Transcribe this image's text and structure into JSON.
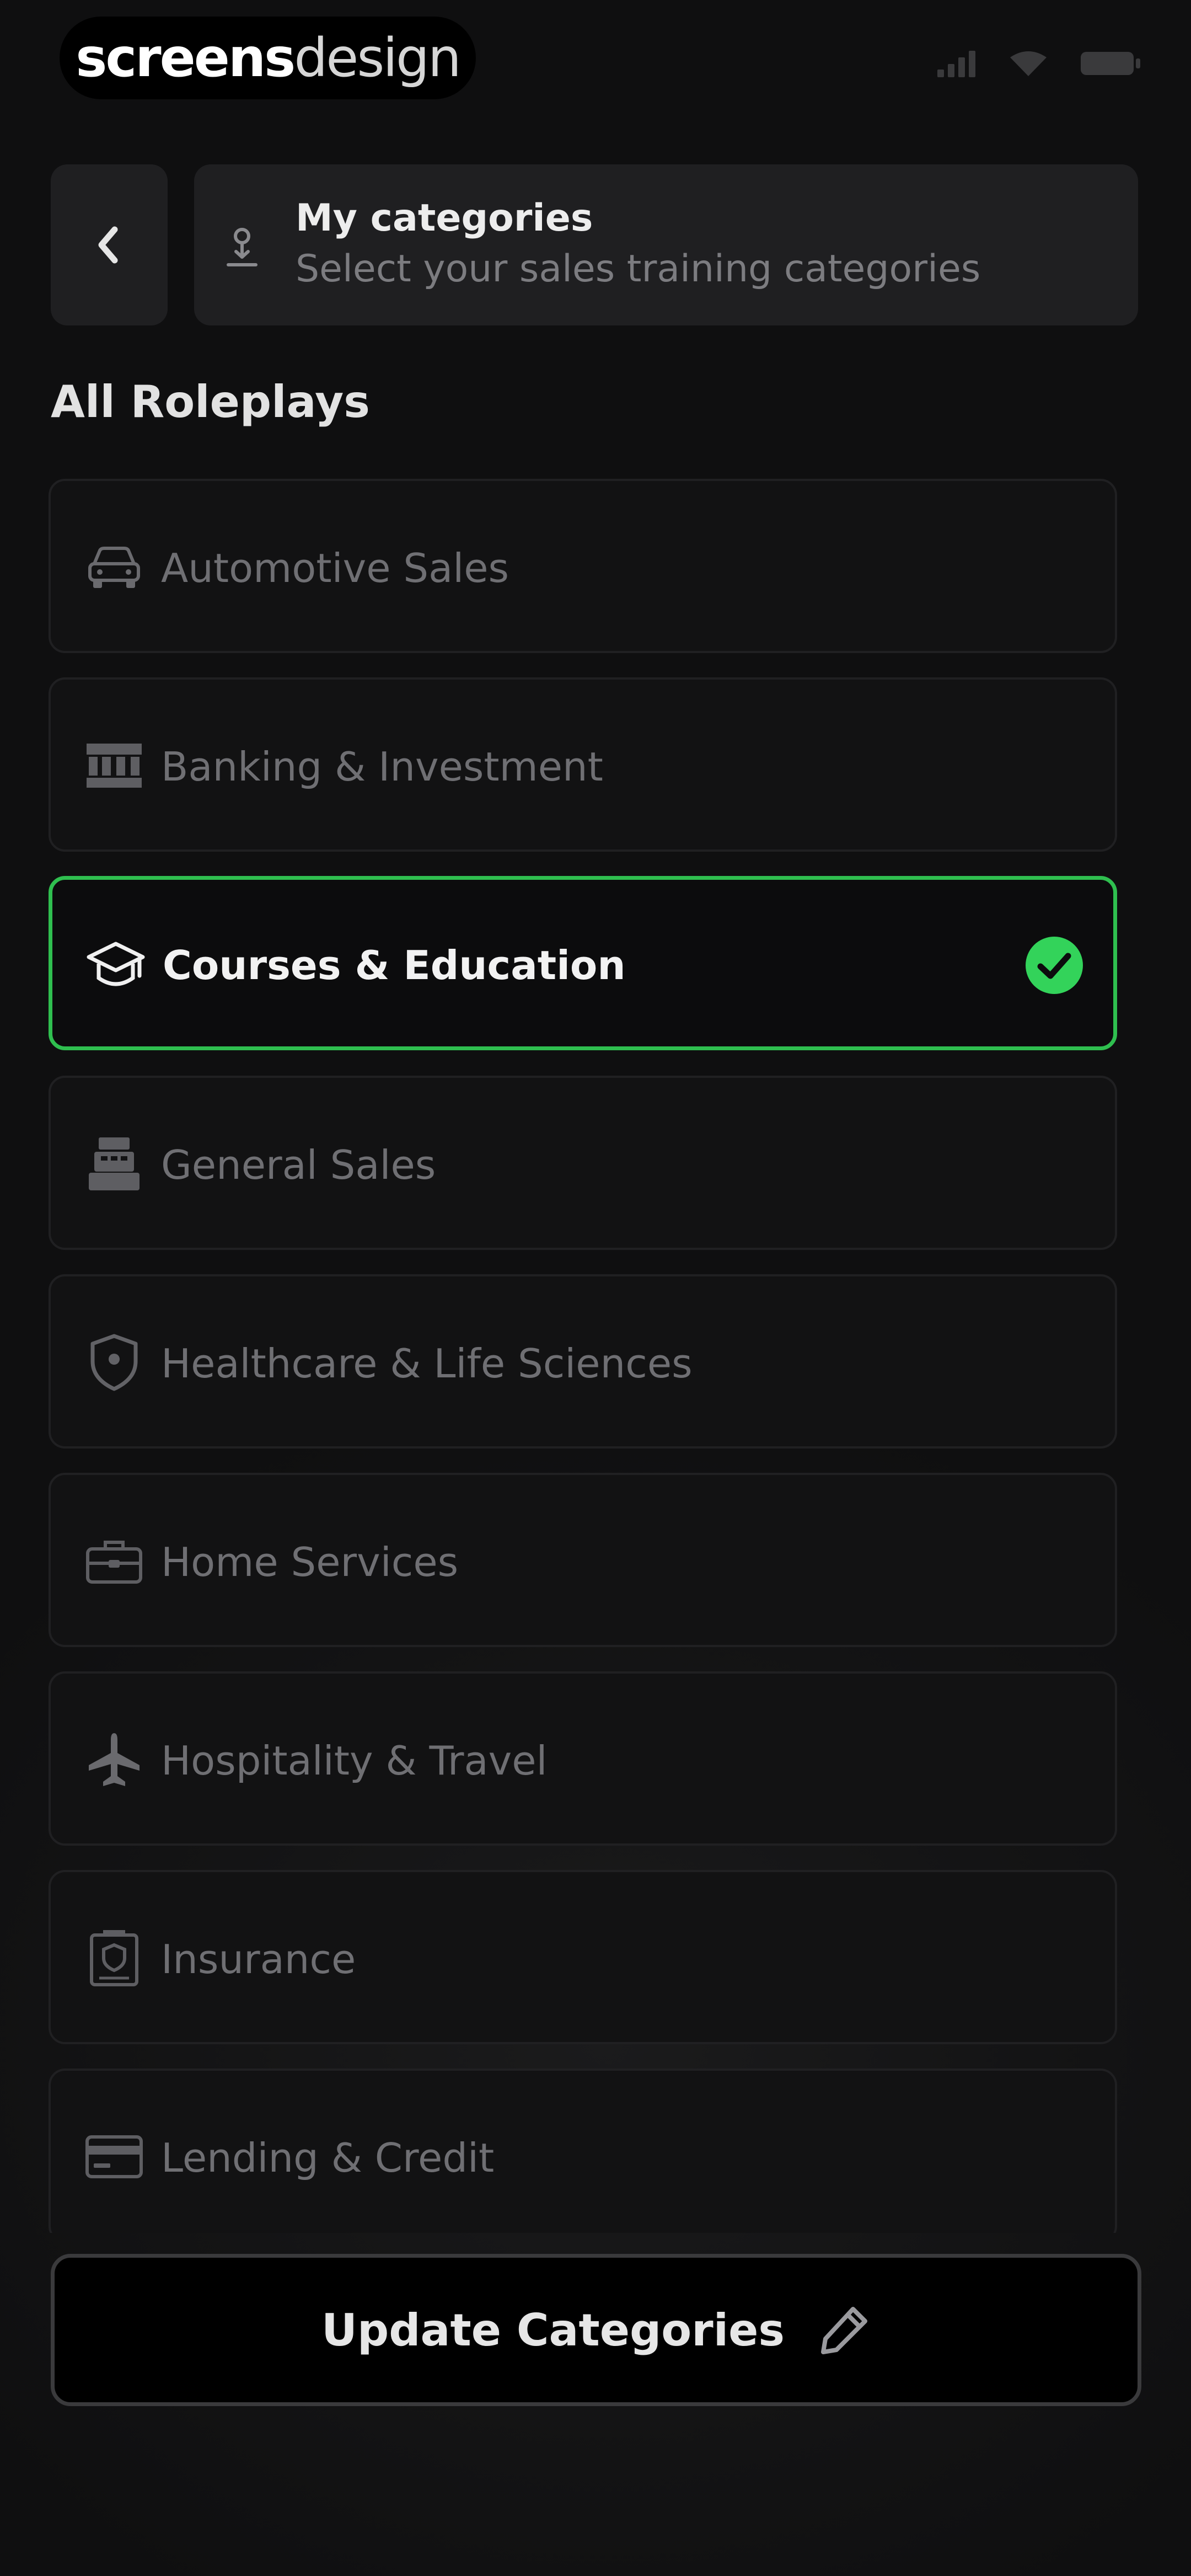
{
  "status_bar": {
    "brand_bold": "screens",
    "brand_light": "design",
    "icons": [
      "signal-icon",
      "wifi-icon",
      "battery-icon"
    ]
  },
  "header": {
    "back_icon": "chevron-left-icon",
    "icon": "person-download-icon",
    "title": "My categories",
    "subtitle": "Select your sales training categories"
  },
  "section": {
    "title": "All Roleplays"
  },
  "categories": [
    {
      "label": "Automotive Sales",
      "icon": "car-icon",
      "selected": false
    },
    {
      "label": "Banking & Investment",
      "icon": "bank-icon",
      "selected": false
    },
    {
      "label": "Courses & Education",
      "icon": "graduation-cap-icon",
      "selected": true
    },
    {
      "label": "General Sales",
      "icon": "cash-register-icon",
      "selected": false
    },
    {
      "label": "Healthcare & Life Sciences",
      "icon": "shield-icon",
      "selected": false
    },
    {
      "label": "Home Services",
      "icon": "toolbox-icon",
      "selected": false
    },
    {
      "label": "Hospitality & Travel",
      "icon": "airplane-icon",
      "selected": false
    },
    {
      "label": "Insurance",
      "icon": "insurance-document-icon",
      "selected": false
    },
    {
      "label": "Lending & Credit",
      "icon": "credit-card-icon",
      "selected": false
    }
  ],
  "update_button": {
    "label": "Update Categories",
    "icon": "pencil-icon"
  },
  "colors": {
    "background": "#111112",
    "card": "#1f1f21",
    "accent_green": "#2fbf4f",
    "muted_text": "#6f6f73"
  }
}
